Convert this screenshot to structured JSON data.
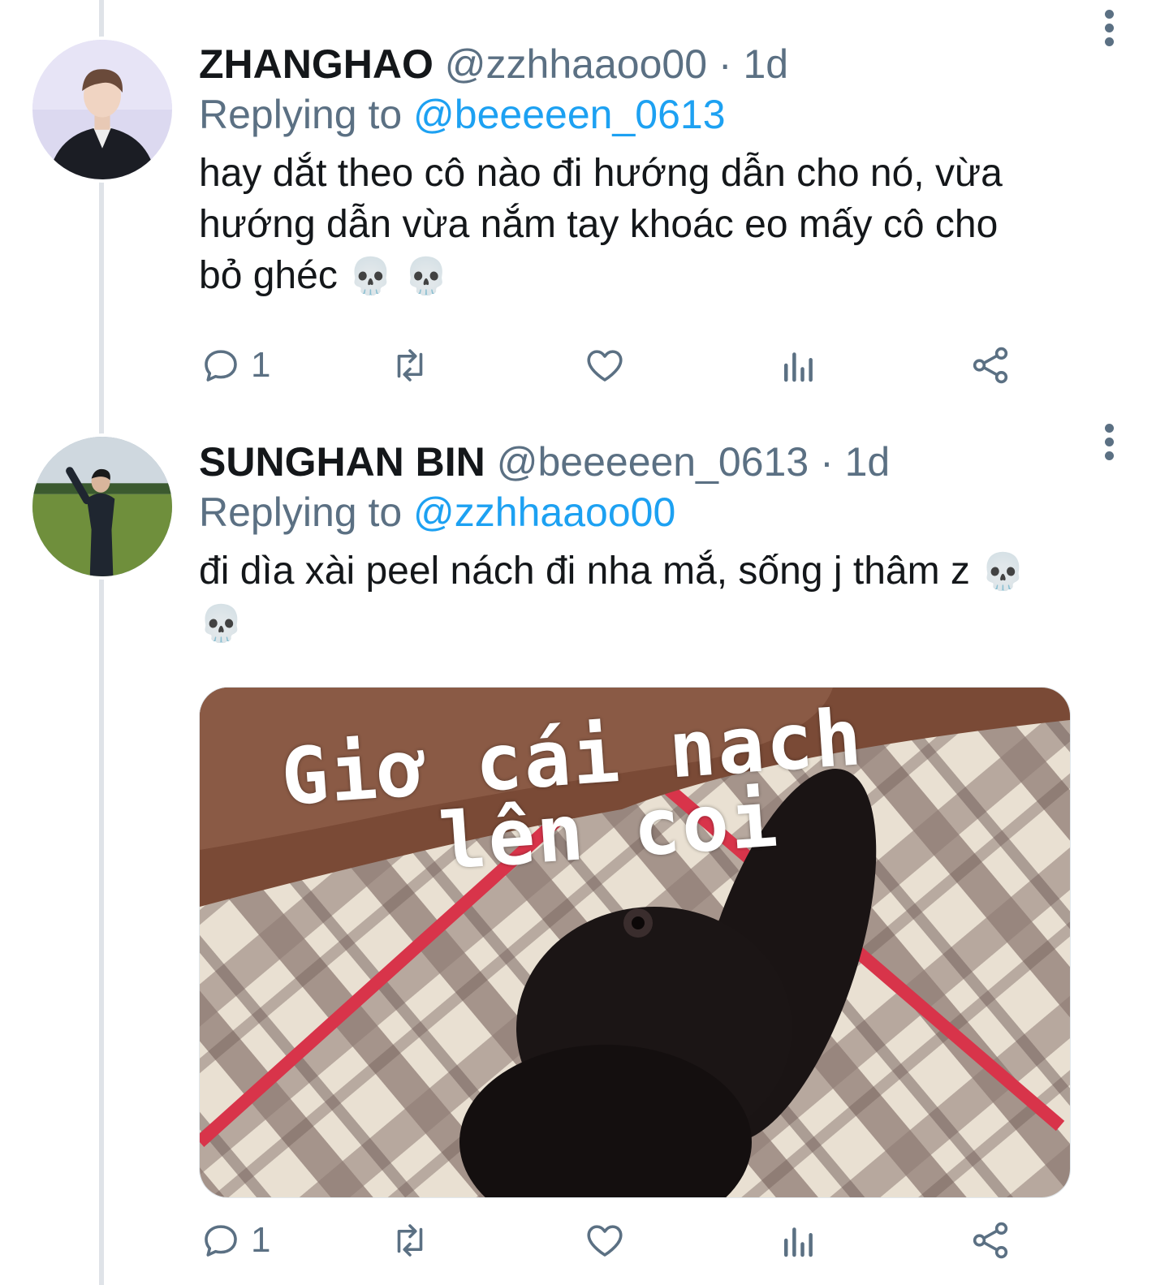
{
  "tweets": [
    {
      "name": "ZHANGHAO",
      "handle": "@zzhhaaoo00",
      "dot": "·",
      "time": "1d",
      "replying_prefix": "Replying to ",
      "replying_to": "@beeeeen_0613",
      "text": "hay dắt theo cô nào đi hướng dẫn cho nó, vừa\nhướng dẫn vừa nắm tay khoác eo mấy cô cho\nbỏ ghéc",
      "emoji": "💀 💀",
      "reply_count": "1",
      "avatar_icon": "profile-photo-man-black-hoodie"
    },
    {
      "name": "SUNGHAN BIN",
      "handle": "@beeeeen_0613",
      "dot": "·",
      "time": "1d",
      "replying_prefix": "Replying to ",
      "replying_to": "@zzhhaaoo00",
      "text": "đi dìa xài peel nách đi nha mắ, sống j thâm z ",
      "emoji": "💀\n💀",
      "reply_count": "1",
      "avatar_icon": "profile-photo-man-in-field",
      "media": {
        "caption_line1": "Giơ cái nach",
        "caption_line2": "lên coi",
        "icon": "black-kitten-raising-paw-meme-photo"
      }
    }
  ],
  "colors": {
    "text": "#14171a",
    "secondary": "#5b7083",
    "accent": "#1da1f2",
    "thread_line": "#dfe3e8"
  },
  "icons": [
    "reply-icon",
    "retweet-icon",
    "like-icon",
    "stats-icon",
    "share-icon",
    "more-icon"
  ]
}
